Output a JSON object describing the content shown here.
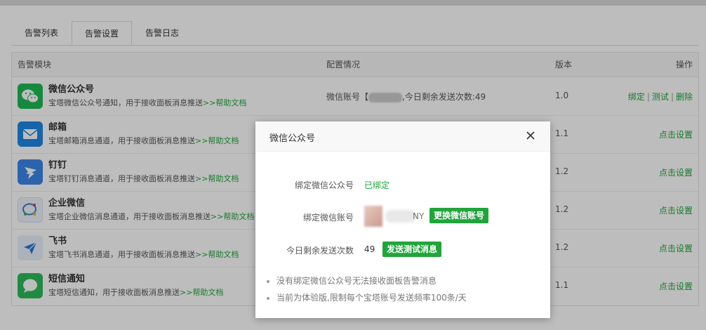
{
  "tabs": [
    {
      "label": "告警列表"
    },
    {
      "label": "告警设置"
    },
    {
      "label": "告警日志"
    }
  ],
  "table": {
    "headers": {
      "module": "告警模块",
      "config": "配置情况",
      "version": "版本",
      "ops": "操作"
    },
    "rows": [
      {
        "icon": "wechat-icon",
        "title": "微信公众号",
        "desc": "宝塔微信公众号通知，用于接收面板消息推送",
        "help": ">>帮助文档",
        "config_prefix": "微信账号【",
        "config_suffix": ",今日剩余发送次数:49",
        "version": "1.0",
        "ops": [
          "绑定",
          "测试",
          "删除"
        ]
      },
      {
        "icon": "mail-icon",
        "title": "邮箱",
        "desc": "宝塔邮箱消息通道，用于接收面板消息推送",
        "help": ">>帮助文档",
        "version": "1.1",
        "ops": [
          "点击设置"
        ]
      },
      {
        "icon": "dingtalk-icon",
        "title": "钉钉",
        "desc": "宝塔钉钉消息通道，用于接收面板消息推送",
        "help": ">>帮助文档",
        "version": "1.2",
        "ops": [
          "点击设置"
        ]
      },
      {
        "icon": "wecom-icon",
        "title": "企业微信",
        "desc": "宝塔企业微信消息通道，用于接收面板消息推送",
        "help": ">>帮助文档",
        "version": "1.2",
        "ops": [
          "点击设置"
        ]
      },
      {
        "icon": "feishu-icon",
        "title": "飞书",
        "desc": "宝塔飞书消息通道，用于接收面板消息推送",
        "help": ">>帮助文档",
        "version": "1.2",
        "ops": [
          "点击设置"
        ]
      },
      {
        "icon": "sms-icon",
        "title": "短信通知",
        "desc": "宝塔短信通知，用于接收面板消息推送",
        "help": ">>帮助文档",
        "version": "1.1",
        "ops": [
          "点击设置"
        ]
      }
    ]
  },
  "modal": {
    "title": "微信公众号",
    "bind_label": "绑定微信公众号",
    "bind_status": "已绑定",
    "account_label": "绑定微信账号",
    "account_suffix": "NY",
    "change_button": "更换微信账号",
    "remaining_label": "今日剩余发送次数",
    "remaining_value": "49",
    "test_button": "发送测试消息",
    "tips": [
      "没有绑定微信公众号无法接收面板告警消息",
      "当前为体验版,限制每个宝塔账号发送频率100条/天"
    ]
  },
  "colors": {
    "accent": "#20a53a",
    "wechat": "#20b954",
    "mail": "#1e88e5",
    "dingtalk": "#3a86e8",
    "feishu": "#1f78e0",
    "sms": "#2dbb5a"
  }
}
